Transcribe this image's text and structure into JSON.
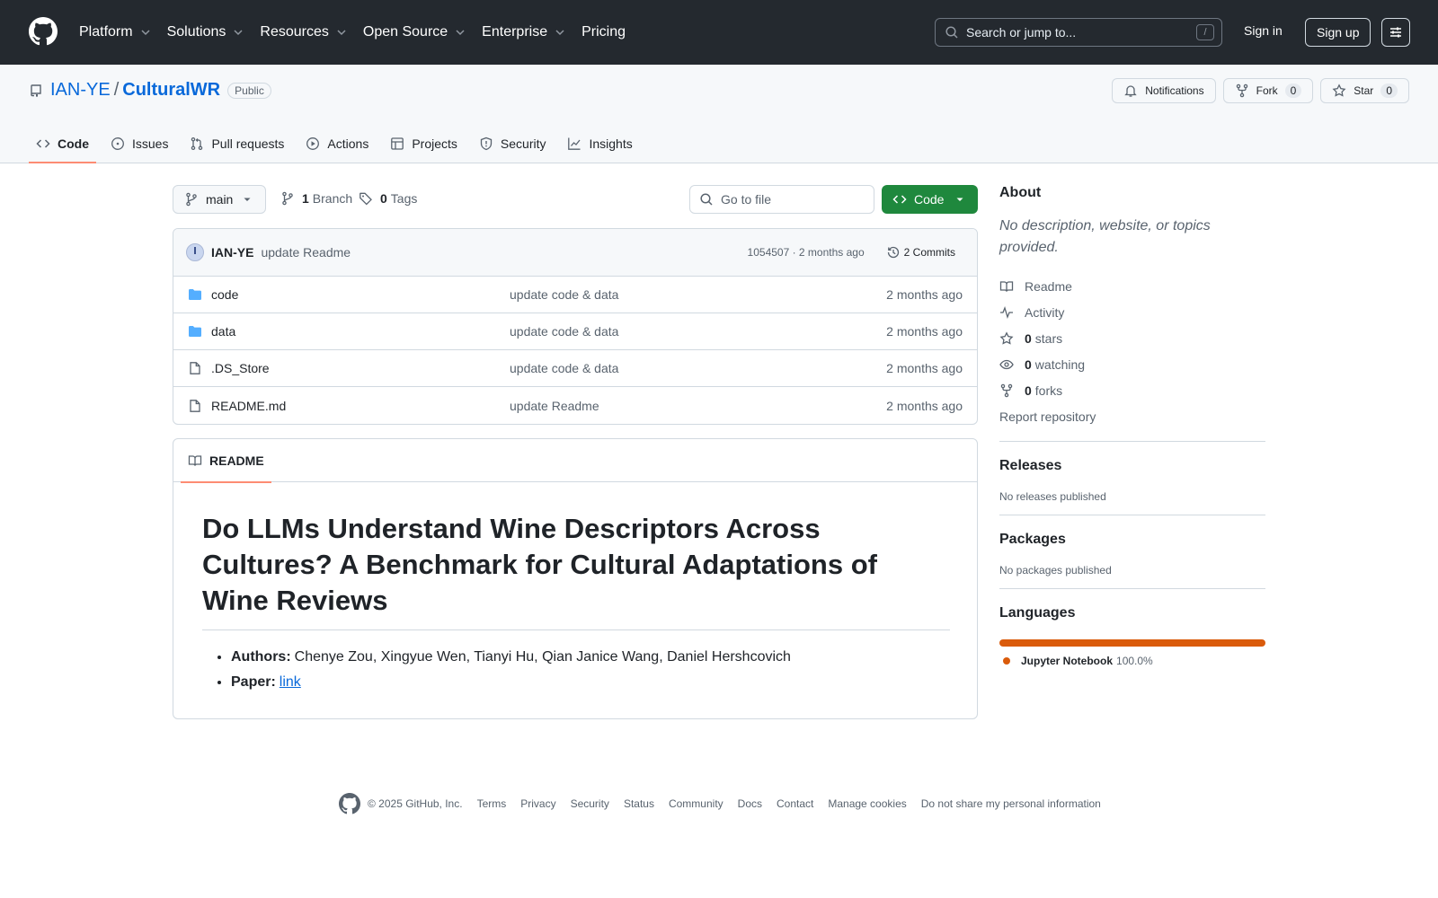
{
  "header": {
    "nav": [
      "Platform",
      "Solutions",
      "Resources",
      "Open Source",
      "Enterprise",
      "Pricing"
    ],
    "search_placeholder": "Search or jump to...",
    "search_shortcut": "/",
    "sign_in": "Sign in",
    "sign_up": "Sign up"
  },
  "repo": {
    "owner": "IAN-YE",
    "separator": "/",
    "name": "CulturalWR",
    "visibility": "Public",
    "notifications_label": "Notifications",
    "fork_label": "Fork",
    "fork_count": "0",
    "star_label": "Star",
    "star_count": "0",
    "tabs": [
      "Code",
      "Issues",
      "Pull requests",
      "Actions",
      "Projects",
      "Security",
      "Insights"
    ]
  },
  "toolbar": {
    "branch": "main",
    "branch_count": "1",
    "branch_label": "Branch",
    "tag_count": "0",
    "tag_label": "Tags",
    "goto_file_placeholder": "Go to file",
    "code_button": "Code"
  },
  "latest_commit": {
    "author": "IAN-YE",
    "message": "update Readme",
    "meta": "1054507 · 2 months ago",
    "commits_label": "2 Commits"
  },
  "files": [
    {
      "name": "code",
      "type": "folder",
      "commit": "update code & data",
      "age": "2 months ago"
    },
    {
      "name": "data",
      "type": "folder",
      "commit": "update code & data",
      "age": "2 months ago"
    },
    {
      "name": ".DS_Store",
      "type": "file",
      "commit": "update code & data",
      "age": "2 months ago"
    },
    {
      "name": "README.md",
      "type": "file",
      "commit": "update Readme",
      "age": "2 months ago"
    }
  ],
  "readme": {
    "tab_label": "README",
    "title": "Do LLMs Understand Wine Descriptors Across Cultures? A Benchmark for Cultural Adaptations of Wine Reviews",
    "authors_label": "Authors:",
    "authors": "Chenye Zou, Xingyue Wen, Tianyi Hu, Qian Janice Wang, Daniel Hershcovich",
    "paper_label": "Paper:",
    "paper_link": "link"
  },
  "sidebar": {
    "about_title": "About",
    "about_desc": "No description, website, or topics provided.",
    "readme": "Readme",
    "activity": "Activity",
    "stars_count": "0",
    "stars_label": "stars",
    "watching_count": "0",
    "watching_label": "watching",
    "forks_count": "0",
    "forks_label": "forks",
    "report": "Report repository",
    "releases_title": "Releases",
    "releases_text": "No releases published",
    "packages_title": "Packages",
    "packages_text": "No packages published",
    "languages_title": "Languages",
    "language_name": "Jupyter Notebook",
    "language_pct": "100.0%",
    "language_color": "#DA5B0B"
  },
  "footer": {
    "copyright": "© 2025 GitHub, Inc.",
    "links": [
      "Terms",
      "Privacy",
      "Security",
      "Status",
      "Community",
      "Docs",
      "Contact",
      "Manage cookies",
      "Do not share my personal information"
    ]
  },
  "colors": {
    "header_bg": "#24292f",
    "accent_link": "#0969da",
    "code_button": "#1f883d",
    "tab_underline": "#fd8c73",
    "folder_icon": "#54aeff"
  }
}
